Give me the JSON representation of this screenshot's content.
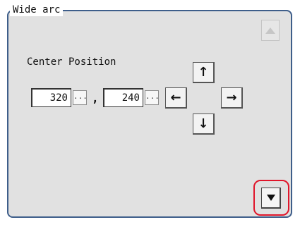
{
  "panel": {
    "title": "Wide arc",
    "center_position_label": "Center Position",
    "x_value": "320",
    "y_value": "240",
    "ellipsis_label": "...",
    "separator": ",",
    "arrows": {
      "up": "↑",
      "left": "←",
      "right": "→",
      "down": "↓"
    }
  },
  "colors": {
    "panel_border": "#3e5e8a",
    "panel_bg": "#e1e1e1",
    "focus_ring": "#e0162b"
  },
  "icons": {
    "scroll_up": "triangle-up-icon",
    "scroll_down": "triangle-down-icon"
  }
}
